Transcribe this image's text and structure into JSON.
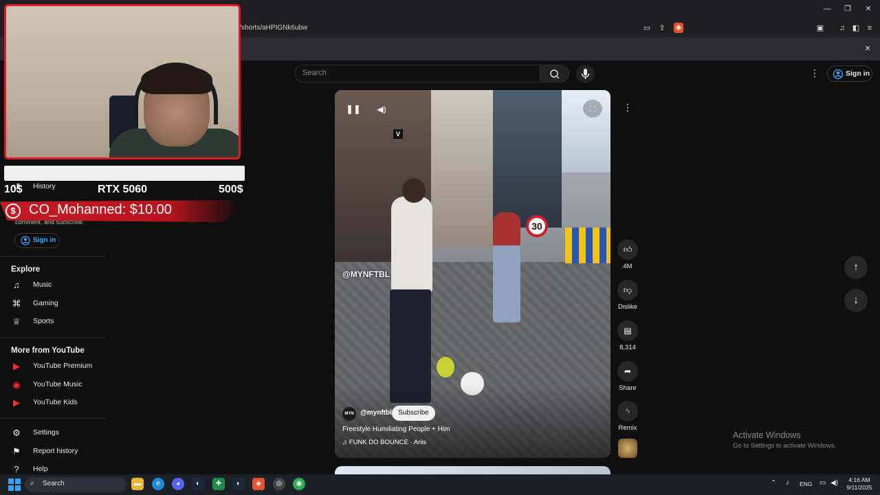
{
  "browser": {
    "url": "m/shorts/aHPIGNk6ubw",
    "window_controls": {
      "minimize": "—",
      "restore": "❐",
      "close": "✕"
    },
    "panel_close": "✕"
  },
  "header": {
    "search_placeholder": "Search",
    "signin_label": "Sign in"
  },
  "stream_overlay": {
    "goal_left": "10$",
    "goal_title": "RTX 5060",
    "goal_right": "500$",
    "donation_text": "CO_Mohanned: $10.00",
    "donation_icon": "$"
  },
  "sidebar": {
    "history_label": "History",
    "signin_prompt": "comment, and subscribe.",
    "signin_label": "Sign in",
    "explore_heading": "Explore",
    "explore_items": [
      {
        "label": "Music",
        "icon": "♫"
      },
      {
        "label": "Gaming",
        "icon": "⌘"
      },
      {
        "label": "Sports",
        "icon": "♕"
      }
    ],
    "more_heading": "More from YouTube",
    "more_items": [
      {
        "label": "YouTube Premium"
      },
      {
        "label": "YouTube Music"
      },
      {
        "label": "YouTube Kids"
      }
    ],
    "footer_items": [
      {
        "label": "Settings",
        "icon": "⚙"
      },
      {
        "label": "Report history",
        "icon": "⚑"
      },
      {
        "label": "Help",
        "icon": "?"
      }
    ]
  },
  "video": {
    "watermark": "@MYNFTBL",
    "sign_number": "30",
    "channel_avatar_text": "MYN",
    "channel_handle": "@mynftbl",
    "subscribe_label": "Subscribe",
    "title": "Freestyle Humiliating People + Him",
    "music": "♫ FUNK DO BOUNCE · Ariis",
    "v_logo": "V"
  },
  "actions": {
    "like_count": "4M",
    "dislike_label": "Dislike",
    "comments_count": "8,314",
    "share_label": "Share",
    "remix_label": "Remix"
  },
  "activation": {
    "title": "Activate Windows",
    "subtitle": "Go to Settings to activate Windows."
  },
  "taskbar": {
    "search_label": "Search",
    "language": "ENG",
    "time": "4:16 AM",
    "date": "9/11/2025"
  }
}
